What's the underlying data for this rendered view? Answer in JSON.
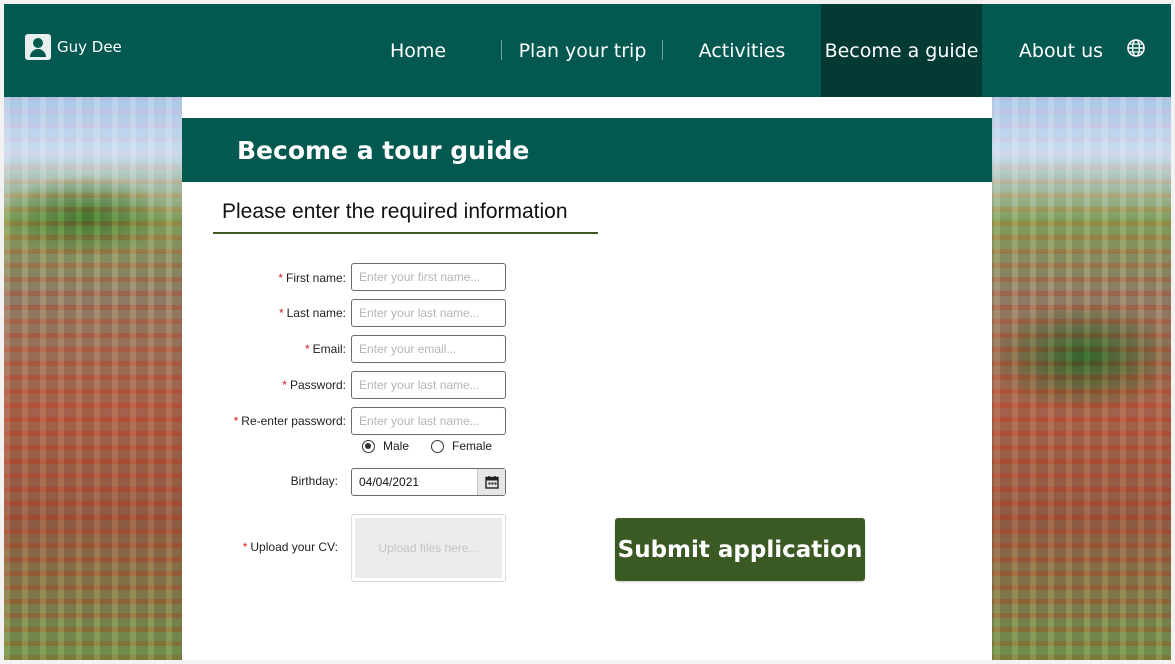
{
  "header": {
    "user_name": "Guy Dee",
    "nav": [
      {
        "label": "Home"
      },
      {
        "label": "Plan your trip"
      },
      {
        "label": "Activities"
      },
      {
        "label": "Become a guide",
        "active": true
      },
      {
        "label": "About us"
      }
    ],
    "language_icon": "globe-icon"
  },
  "banner": {
    "title": "Become a tour guide"
  },
  "form": {
    "subtitle": "Please enter the required information",
    "required_marker": "*",
    "first_name": {
      "label": "First name:",
      "placeholder": "Enter your first name...",
      "value": ""
    },
    "last_name": {
      "label": "Last name:",
      "placeholder": "Enter your last name...",
      "value": ""
    },
    "email": {
      "label": "Email:",
      "placeholder": "Enter your email...",
      "value": ""
    },
    "password": {
      "label": "Password:",
      "placeholder": "Enter your last name...",
      "value": ""
    },
    "reenter_password": {
      "label": "Re-enter password:",
      "placeholder": "Enter your last name...",
      "value": ""
    },
    "gender": {
      "options": [
        "Male",
        "Female"
      ],
      "selected": "Male"
    },
    "birthday": {
      "label": "Birthday:",
      "value": "04/04/2021"
    },
    "cv": {
      "label": "Upload your CV:",
      "placeholder": "Upload files here..."
    },
    "submit_label": "Submit application"
  },
  "colors": {
    "header_bg": "#03594f",
    "active_nav_bg": "#033a33",
    "submit_bg": "#3b5a23",
    "required": "#cc2222"
  }
}
